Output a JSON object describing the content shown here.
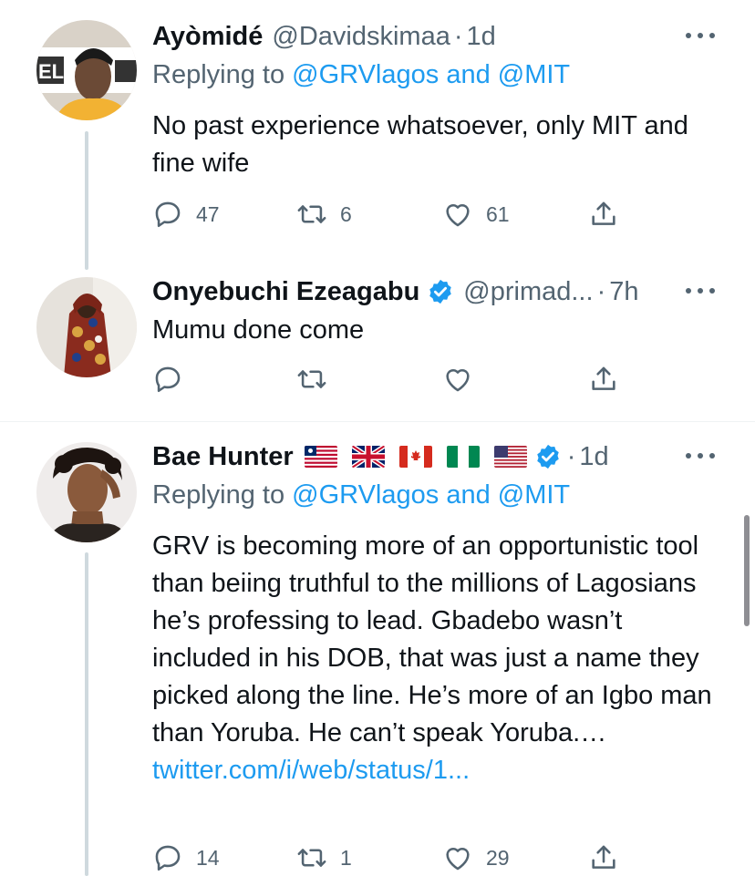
{
  "tweets": [
    {
      "name": "Ayòmidé",
      "handle": "@Davidskimaa",
      "dot": "·",
      "time": "1d",
      "replying_prefix": "Replying to",
      "replying_user1": "@GRVlagos",
      "replying_and": "and",
      "replying_user2": "@MIT",
      "text": "No past experience whatsoever, only MIT and fine wife",
      "replies": "47",
      "retweets": "6",
      "likes": "61"
    },
    {
      "name": "Onyebuchi Ezeagabu",
      "handle": "@primad...",
      "dot": "·",
      "time": "7h",
      "text": "Mumu done come"
    },
    {
      "name": "Bae Hunter",
      "flags": [
        "flag-liberia-icon",
        "flag-uk-icon",
        "flag-canada-icon",
        "flag-nigeria-icon",
        "flag-usa-icon"
      ],
      "dot": "·",
      "time": "1d",
      "replying_prefix": "Replying to",
      "replying_user1": "@GRVlagos",
      "replying_and": "and",
      "replying_user2": "@MIT",
      "text": "GRV is becoming more of an opportunistic tool than beiing truthful to the millions of Lagosians he’s professing to lead. Gbadebo wasn’t included in his DOB, that was just a name they picked along the line. He’s more of an Igbo man than Yoruba. He can’t speak Yoruba.…",
      "link": "twitter.com/i/web/status/1...",
      "replies": "14",
      "retweets": "1",
      "likes": "29"
    }
  ],
  "colors": {
    "accent": "#1d9bf0",
    "secondary_text": "#536471",
    "primary_text": "#0f1419",
    "thread_line": "#cfd9de"
  }
}
